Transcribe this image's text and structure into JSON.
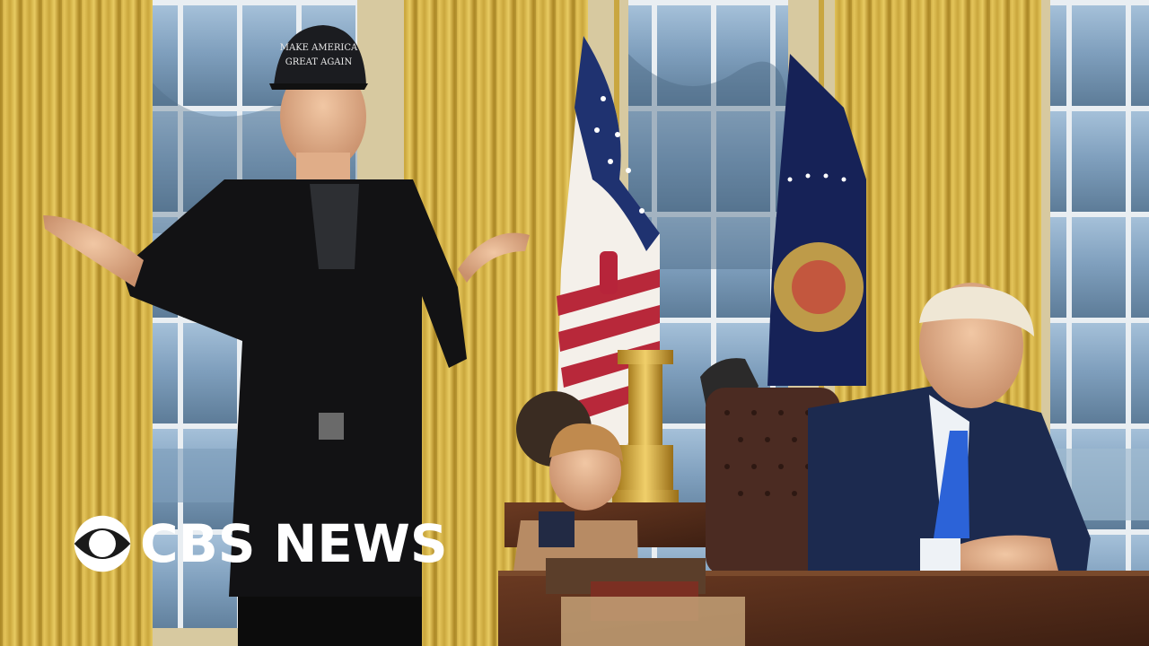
{
  "image": {
    "kind": "news thumbnail photo",
    "scene": "oval-office",
    "colors": {
      "curtain": "#d9b84a",
      "window_glass": "#8fb2cf",
      "suit_navy": "#1c2a4f",
      "coat_black": "#121214",
      "desk_wood": "#5a2e1a",
      "chair_leather": "#4a2a20"
    }
  },
  "hat_text": "MAKE AMERICA GREAT AGAIN",
  "brand": {
    "logo_icon": "cbs-eye-icon",
    "text": "CBS NEWS",
    "color": "#ffffff"
  }
}
